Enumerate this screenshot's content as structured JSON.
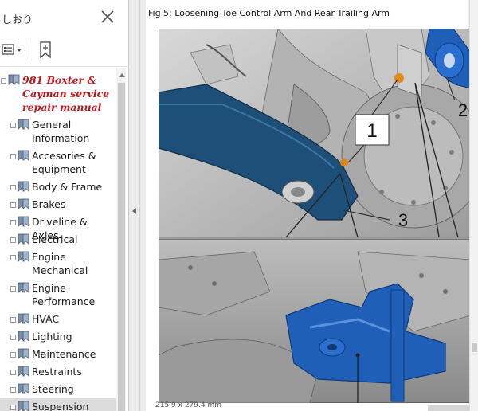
{
  "sidebar": {
    "title": "しおり",
    "close_icon": "close-icon",
    "options_icon": "list-options-icon",
    "bookmark_icon": "new-bookmark-icon",
    "tree": [
      {
        "label": "981 Boxter & Cayman service repair manual",
        "lines": [
          "981 Boxter &",
          "Cayman service",
          "repair manual"
        ],
        "level": 0,
        "toggle": "−"
      },
      {
        "label": "General Information",
        "lines": [
          "General",
          "Information"
        ],
        "level": 1,
        "toggle": "+"
      },
      {
        "label": "Accesories & Equipment",
        "lines": [
          "Accesories &",
          "Equipment"
        ],
        "level": 1,
        "toggle": "+"
      },
      {
        "label": "Body & Frame",
        "lines": [
          "Body & Frame"
        ],
        "level": 1,
        "toggle": "+"
      },
      {
        "label": "Brakes",
        "lines": [
          "Brakes"
        ],
        "level": 1,
        "toggle": "+"
      },
      {
        "label": "Driveline & Axles",
        "lines": [
          "Driveline & Axles"
        ],
        "level": 1,
        "toggle": "+"
      },
      {
        "label": "Electrical",
        "lines": [
          "Electrical"
        ],
        "level": 1,
        "toggle": "+"
      },
      {
        "label": "Engine Mechanical",
        "lines": [
          "Engine",
          "Mechanical"
        ],
        "level": 1,
        "toggle": "+"
      },
      {
        "label": "Engine Performance",
        "lines": [
          "Engine",
          "Performance"
        ],
        "level": 1,
        "toggle": "+"
      },
      {
        "label": "HVAC",
        "lines": [
          "HVAC"
        ],
        "level": 1,
        "toggle": "+"
      },
      {
        "label": "Lighting",
        "lines": [
          "Lighting"
        ],
        "level": 1,
        "toggle": "+"
      },
      {
        "label": "Maintenance",
        "lines": [
          "Maintenance"
        ],
        "level": 1,
        "toggle": "+"
      },
      {
        "label": "Restraints",
        "lines": [
          "Restraints"
        ],
        "level": 1,
        "toggle": "+"
      },
      {
        "label": "Steering",
        "lines": [
          "Steering"
        ],
        "level": 1,
        "toggle": "+"
      },
      {
        "label": "Suspension",
        "lines": [
          "Suspension"
        ],
        "level": 1,
        "toggle": "+",
        "selected": true
      }
    ]
  },
  "document": {
    "caption": "Fig 5: Loosening Toe Control Arm And Rear Trailing Arm",
    "callouts": [
      "1",
      "2",
      "3"
    ],
    "status_text": "215.9 x 279.4 mm"
  },
  "colors": {
    "root_label": "#c0141c",
    "part_blue": "#1f5fb8",
    "part_dark_blue": "#1d4f78",
    "highlight_orange": "#e08a1c"
  }
}
